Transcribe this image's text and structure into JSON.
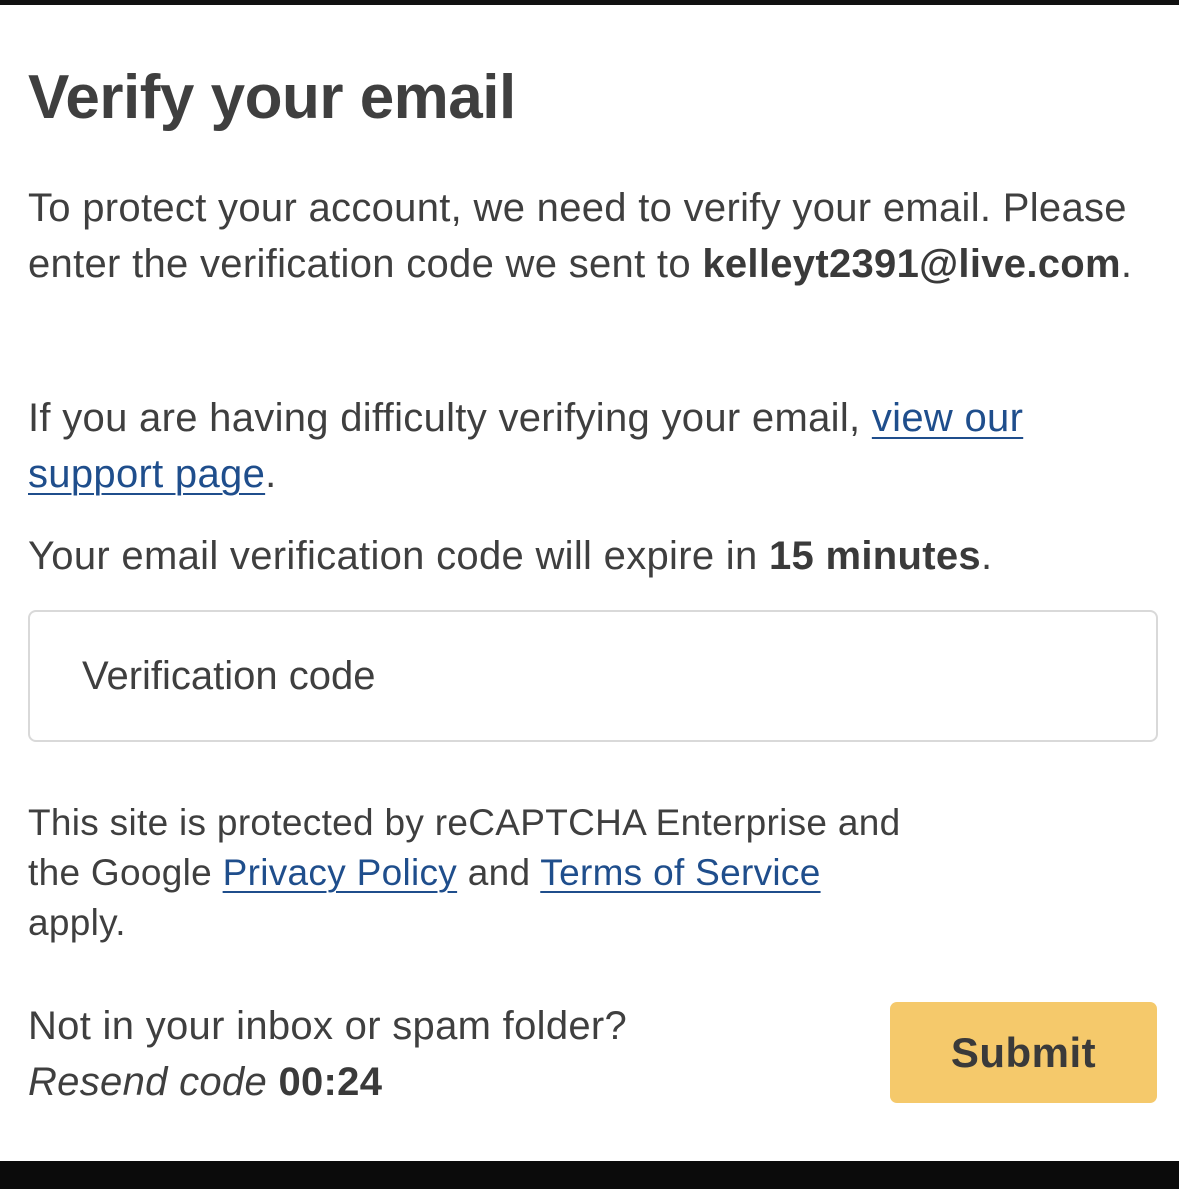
{
  "title": "Verify your email",
  "intro": {
    "line": "To protect your account, we need to verify your email. Please enter the verification code we sent to",
    "email": "kelleyt2391@live.com",
    "end": "."
  },
  "support": {
    "prefix": "If you are having difficulty verifying your email,",
    "link_label": "view our support page",
    "suffix": "."
  },
  "expiry": {
    "prefix": "Your email verification code will expire in",
    "duration": "15 minutes",
    "suffix": "."
  },
  "code_input": {
    "placeholder": "Verification code",
    "value": ""
  },
  "recaptcha": {
    "text_1": "This site is protected by reCAPTCHA Enterprise and the Google",
    "privacy_link": "Privacy Policy",
    "and": "and",
    "terms_link": "Terms of Service",
    "text_2": "apply."
  },
  "resend": {
    "question": "Not in your inbox or spam folder?",
    "link_label": "Resend code",
    "timer": "00:24"
  },
  "submit_label": "Submit",
  "colors": {
    "text": "#3f3f3f",
    "link": "#1f4e8c",
    "submit_bg": "#f5c96b",
    "input_border": "#d9d9d9"
  }
}
